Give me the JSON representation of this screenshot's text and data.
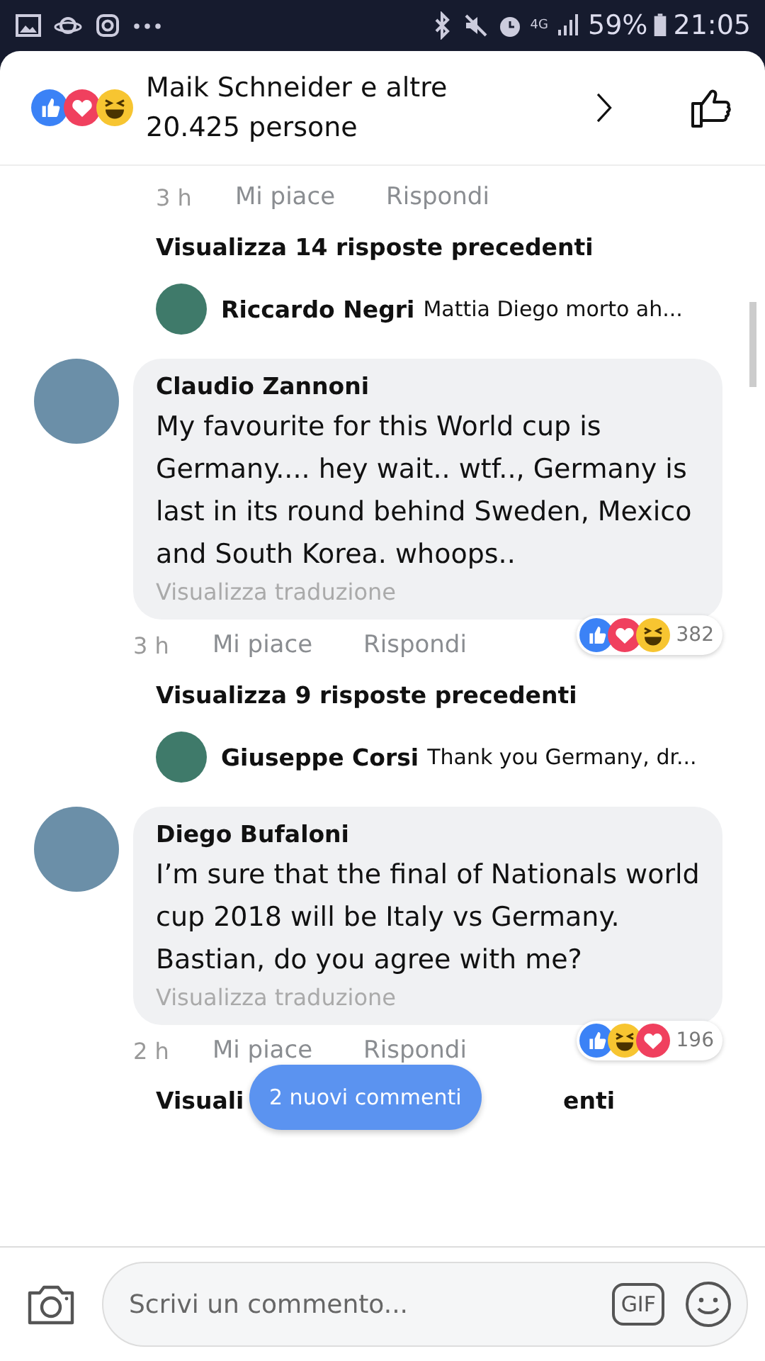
{
  "status_bar": {
    "time": "21:05",
    "battery": "59%",
    "network": "4G"
  },
  "header": {
    "reactions": [
      {
        "kind": "like"
      },
      {
        "kind": "love"
      },
      {
        "kind": "haha"
      }
    ],
    "text": "Maik Schneider e altre 20.425 persone"
  },
  "feed": [
    {
      "kind": "actions",
      "time": "3 h",
      "like": "Mi piace",
      "reply": "Rispondi"
    },
    {
      "kind": "more_replies",
      "text": "Visualizza 14 risposte precedenti"
    },
    {
      "kind": "reply_preview",
      "author": "Riccardo Negri",
      "text": "Mattia Diego morto ah..."
    },
    {
      "kind": "comment",
      "author": "Claudio Zannoni",
      "text": "My favourite for this World cup is Germany.... hey wait.. wtf.., Germany is last in its round behind Sweden, Mexico and South Korea. whoops..",
      "translate": "Visualizza traduzione",
      "time": "3 h",
      "like": "Mi piace",
      "reply": "Rispondi",
      "reactions": [
        {
          "kind": "like"
        },
        {
          "kind": "love"
        },
        {
          "kind": "haha"
        }
      ],
      "count": "382"
    },
    {
      "kind": "more_replies",
      "text": "Visualizza 9 risposte precedenti"
    },
    {
      "kind": "reply_preview",
      "author": "Giuseppe Corsi",
      "text": "Thank you Germany, dr..."
    },
    {
      "kind": "comment",
      "author": "Diego Bufaloni",
      "text": "I’m sure that the final of Nationals world cup 2018 will be Italy vs Germany. Bastian, do you agree with me?",
      "translate": "Visualizza traduzione",
      "time": "2 h",
      "like": "Mi piace",
      "reply": "Rispondi",
      "reactions": [
        {
          "kind": "like"
        },
        {
          "kind": "haha"
        },
        {
          "kind": "love"
        }
      ],
      "count": "196"
    },
    {
      "kind": "covered_replies",
      "left": "Visuali",
      "right": "enti"
    }
  ],
  "new_comments": "2 nuovi commenti",
  "composer": {
    "placeholder": "Scrivi un commento...",
    "gif": "GIF"
  }
}
